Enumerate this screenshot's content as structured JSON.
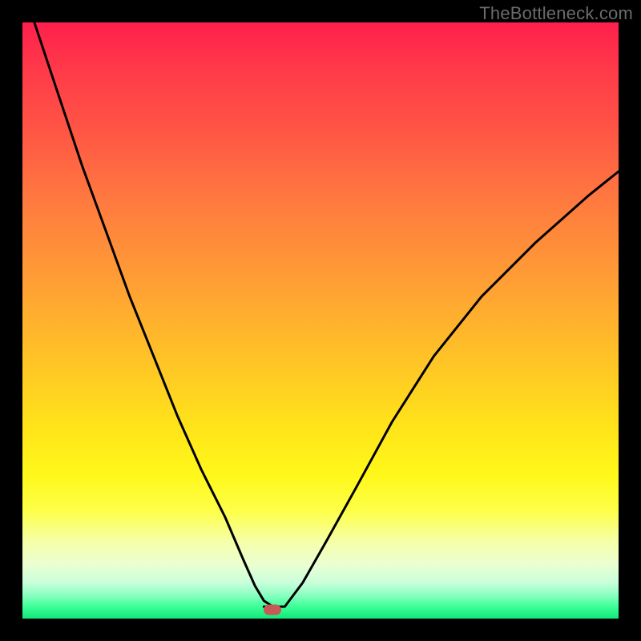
{
  "watermark": "TheBottleneck.com",
  "chart_data": {
    "type": "line",
    "title": "",
    "xlabel": "",
    "ylabel": "",
    "xlim": [
      0,
      100
    ],
    "ylim": [
      0,
      100
    ],
    "grid": false,
    "legend": false,
    "marker": {
      "x": 42,
      "y": 1.5,
      "color": "#c65a55"
    },
    "series": [
      {
        "name": "left-branch",
        "x": [
          2,
          6,
          10,
          14,
          18,
          22,
          26,
          30,
          34,
          37,
          39,
          40.5,
          42
        ],
        "y": [
          100,
          88,
          76,
          65,
          54,
          44,
          34,
          25,
          17,
          10,
          5.5,
          3,
          2
        ]
      },
      {
        "name": "valley-flat",
        "x": [
          40.5,
          44
        ],
        "y": [
          2,
          2
        ]
      },
      {
        "name": "right-branch",
        "x": [
          44,
          47,
          51,
          56,
          62,
          69,
          77,
          86,
          95,
          100
        ],
        "y": [
          2,
          6,
          13,
          22,
          33,
          44,
          54,
          63,
          71,
          75
        ]
      }
    ],
    "background_gradient": {
      "top": "#ff1f4c",
      "mid": "#ffe41a",
      "bottom": "#11e87b"
    }
  }
}
